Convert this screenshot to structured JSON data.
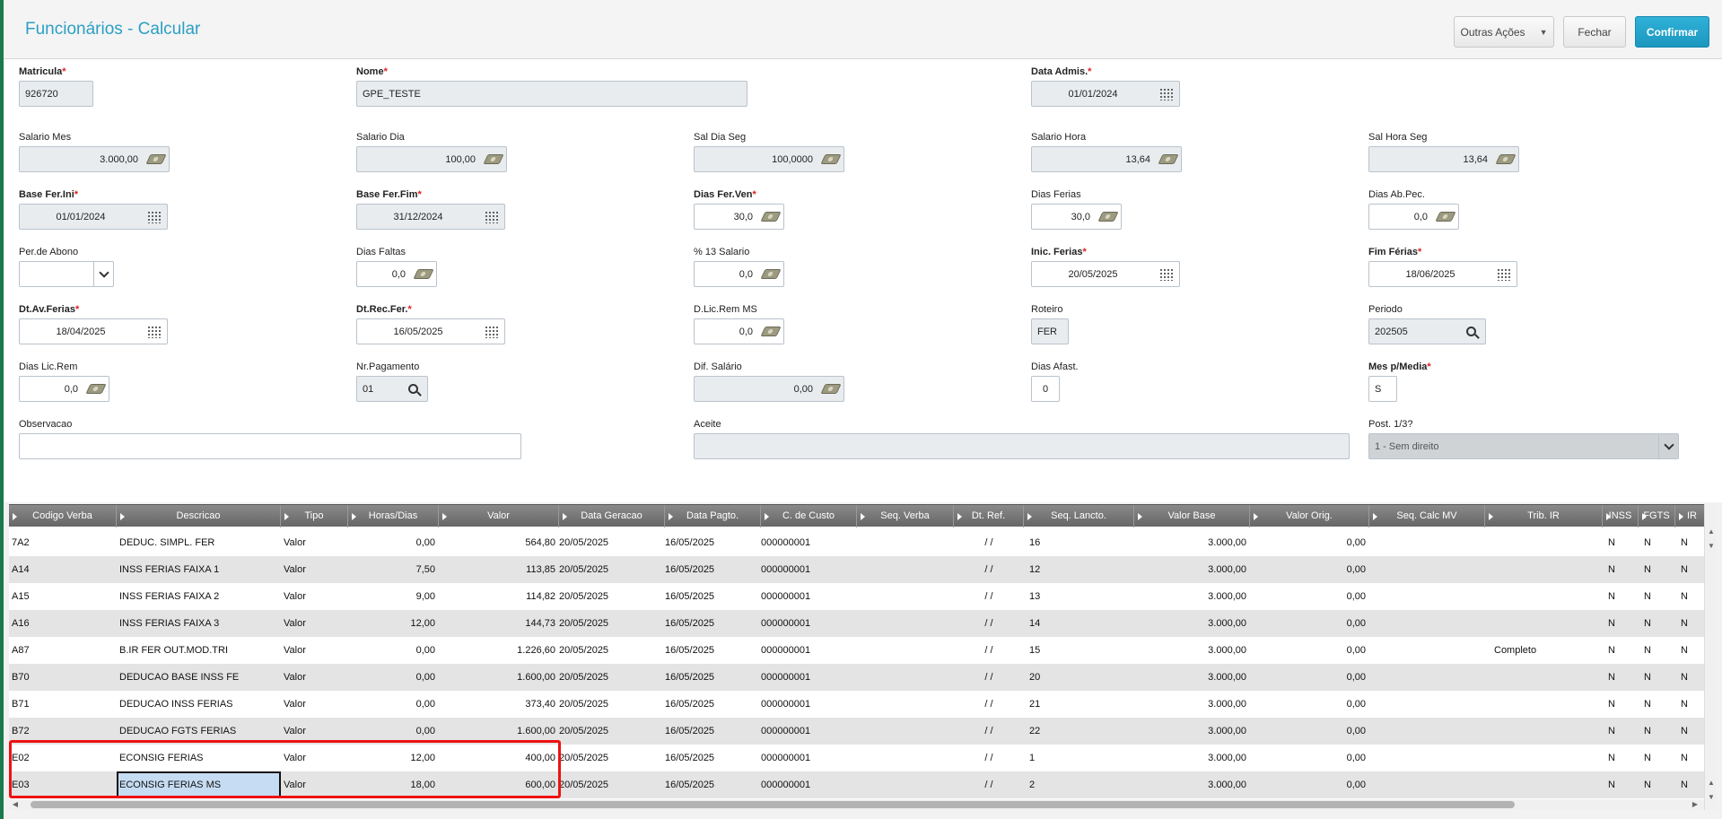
{
  "header": {
    "title": "Funcionários - Calcular",
    "buttons": {
      "other_actions": "Outras Ações",
      "close": "Fechar",
      "confirm": "Confirmar"
    }
  },
  "form": {
    "matricula": {
      "label": "Matricula",
      "value": "926720"
    },
    "nome": {
      "label": "Nome",
      "value": "GPE_TESTE"
    },
    "data_admis": {
      "label": "Data Admis.",
      "value": "01/01/2024"
    },
    "salario_mes": {
      "label": "Salario Mes",
      "value": "3.000,00"
    },
    "salario_dia": {
      "label": "Salario Dia",
      "value": "100,00"
    },
    "sal_dia_seg": {
      "label": "Sal Dia Seg",
      "value": "100,0000"
    },
    "salario_hora": {
      "label": "Salario Hora",
      "value": "13,64"
    },
    "sal_hora_seg": {
      "label": "Sal Hora Seg",
      "value": "13,64"
    },
    "base_fer_ini": {
      "label": "Base Fer.Ini",
      "value": "01/01/2024"
    },
    "base_fer_fim": {
      "label": "Base Fer.Fim",
      "value": "31/12/2024"
    },
    "dias_fer_ven": {
      "label": "Dias Fer.Ven",
      "value": "30,0"
    },
    "dias_ferias": {
      "label": "Dias Ferias",
      "value": "30,0"
    },
    "dias_ab_pec": {
      "label": "Dias Ab.Pec.",
      "value": "0,0"
    },
    "per_abono": {
      "label": "Per.de Abono",
      "value": ""
    },
    "dias_faltas": {
      "label": "Dias Faltas",
      "value": "0,0"
    },
    "pct_13_salario": {
      "label": "% 13 Salario",
      "value": "0,0"
    },
    "inic_ferias": {
      "label": "Inic. Ferias",
      "value": "20/05/2025"
    },
    "fim_ferias": {
      "label": "Fim Férias",
      "value": "18/06/2025"
    },
    "dt_av_ferias": {
      "label": "Dt.Av.Ferias",
      "value": "18/04/2025"
    },
    "dt_rec_fer": {
      "label": "Dt.Rec.Fer.",
      "value": "16/05/2025"
    },
    "d_lic_rem_ms": {
      "label": "D.Lic.Rem MS",
      "value": "0,0"
    },
    "roteiro": {
      "label": "Roteiro",
      "value": "FER"
    },
    "periodo": {
      "label": "Periodo",
      "value": "202505"
    },
    "dias_lic_rem": {
      "label": "Dias Lic.Rem",
      "value": "0,0"
    },
    "nr_pagamento": {
      "label": "Nr.Pagamento",
      "value": "01"
    },
    "dif_salario": {
      "label": "Dif. Salário",
      "value": "0,00"
    },
    "dias_afast": {
      "label": "Dias Afast.",
      "value": "0"
    },
    "mes_p_media": {
      "label": "Mes p/Media",
      "value": "S"
    },
    "observacao": {
      "label": "Observacao",
      "value": ""
    },
    "aceite": {
      "label": "Aceite",
      "value": ""
    },
    "post_1_3": {
      "label": "Post. 1/3?",
      "value": "1 - Sem direito"
    }
  },
  "grid": {
    "columns": [
      "Codigo Verba",
      "Descricao",
      "Tipo",
      "Horas/Dias",
      "Valor",
      "Data Geracao",
      "Data Pagto.",
      "C. de Custo",
      "Seq. Verba",
      "Dt. Ref.",
      "Seq. Lancto.",
      "Valor Base",
      "Valor Orig.",
      "Seq. Calc MV",
      "Trib. IR",
      "INSS",
      "FGTS",
      "IR"
    ],
    "rows": [
      [
        "7A2",
        "DEDUC. SIMPL. FER",
        "Valor",
        "0,00",
        "564,80",
        "20/05/2025",
        "16/05/2025",
        "000000001",
        "",
        " /  /",
        "16",
        "3.000,00",
        "0,00",
        "",
        "",
        "N",
        "N",
        "N"
      ],
      [
        "A14",
        "INSS FERIAS FAIXA 1",
        "Valor",
        "7,50",
        "113,85",
        "20/05/2025",
        "16/05/2025",
        "000000001",
        "",
        " /  /",
        "12",
        "3.000,00",
        "0,00",
        "",
        "",
        "N",
        "N",
        "N"
      ],
      [
        "A15",
        "INSS FERIAS FAIXA 2",
        "Valor",
        "9,00",
        "114,82",
        "20/05/2025",
        "16/05/2025",
        "000000001",
        "",
        " /  /",
        "13",
        "3.000,00",
        "0,00",
        "",
        "",
        "N",
        "N",
        "N"
      ],
      [
        "A16",
        "INSS FERIAS FAIXA 3",
        "Valor",
        "12,00",
        "144,73",
        "20/05/2025",
        "16/05/2025",
        "000000001",
        "",
        " /  /",
        "14",
        "3.000,00",
        "0,00",
        "",
        "",
        "N",
        "N",
        "N"
      ],
      [
        "A87",
        "B.IR FER OUT.MOD.TRI",
        "Valor",
        "0,00",
        "1.226,60",
        "20/05/2025",
        "16/05/2025",
        "000000001",
        "",
        " /  /",
        "15",
        "3.000,00",
        "0,00",
        "",
        "Completo",
        "N",
        "N",
        "N"
      ],
      [
        "B70",
        "DEDUCAO BASE INSS FE",
        "Valor",
        "0,00",
        "1.600,00",
        "20/05/2025",
        "16/05/2025",
        "000000001",
        "",
        " /  /",
        "20",
        "3.000,00",
        "0,00",
        "",
        "",
        "N",
        "N",
        "N"
      ],
      [
        "B71",
        "DEDUCAO INSS FERIAS",
        "Valor",
        "0,00",
        "373,40",
        "20/05/2025",
        "16/05/2025",
        "000000001",
        "",
        " /  /",
        "21",
        "3.000,00",
        "0,00",
        "",
        "",
        "N",
        "N",
        "N"
      ],
      [
        "B72",
        "DEDUCAO FGTS FERIAS",
        "Valor",
        "0,00",
        "1.600,00",
        "20/05/2025",
        "16/05/2025",
        "000000001",
        "",
        " /  /",
        "22",
        "3.000,00",
        "0,00",
        "",
        "",
        "N",
        "N",
        "N"
      ],
      [
        "E02",
        "ECONSIG FERIAS",
        "Valor",
        "12,00",
        "400,00",
        "20/05/2025",
        "16/05/2025",
        "000000001",
        "",
        " /  /",
        "1",
        "3.000,00",
        "0,00",
        "",
        "",
        "N",
        "N",
        "N"
      ],
      [
        "E03",
        "ECONSIG FERIAS MS",
        "Valor",
        "18,00",
        "600,00",
        "20/05/2025",
        "16/05/2025",
        "000000001",
        "",
        " /  /",
        "2",
        "3.000,00",
        "0,00",
        "",
        "",
        "N",
        "N",
        "N"
      ]
    ]
  }
}
